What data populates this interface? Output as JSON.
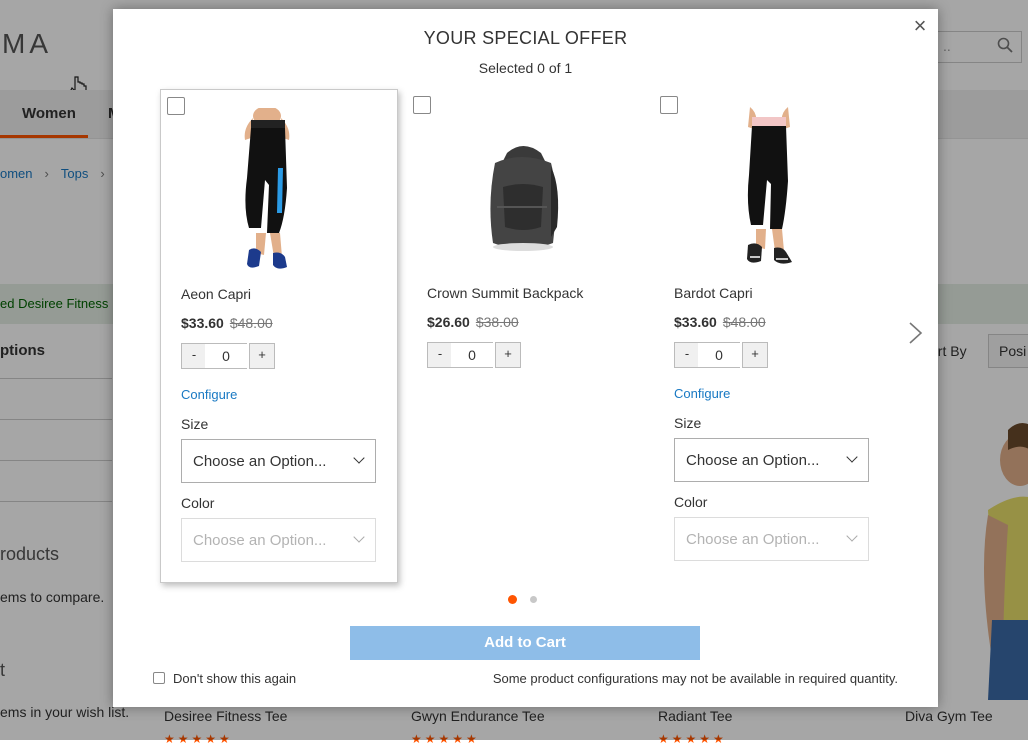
{
  "background": {
    "logo_text": "MA",
    "search_placeholder": "..",
    "nav": {
      "active_label": "Women",
      "next_label": "M"
    },
    "breadcrumb": [
      "omen",
      "Tops"
    ],
    "message_text": "ed Desiree Fitness",
    "options_heading": "ptions",
    "products_heading": "roducts",
    "compare_text": "ems to compare.",
    "wishlist_heading": "t",
    "wishlist_text": "ems in your wish list.",
    "sort_by_label": "ort By",
    "sort_value": "Posi",
    "product_names": [
      "Desiree Fitness Tee",
      "Gwyn Endurance Tee",
      "Radiant Tee",
      "Diva Gym Tee"
    ],
    "stars_glyph": "★★★★★"
  },
  "modal": {
    "title": "YOUR SPECIAL OFFER",
    "subtitle": "Selected 0 of 1",
    "close_glyph": "×",
    "products": [
      {
        "name": "Aeon Capri",
        "price": "$33.60",
        "old_price": "$48.00",
        "qty": "0",
        "minus": "-",
        "plus": "+",
        "configure": "Configure",
        "size_label": "Size",
        "size_value": "Choose an Option...",
        "color_label": "Color",
        "color_value": "Choose an Option..."
      },
      {
        "name": "Crown Summit Backpack",
        "price": "$26.60",
        "old_price": "$38.00",
        "qty": "0",
        "minus": "-",
        "plus": "+"
      },
      {
        "name": "Bardot Capri",
        "price": "$33.60",
        "old_price": "$48.00",
        "qty": "0",
        "minus": "-",
        "plus": "+",
        "configure": "Configure",
        "size_label": "Size",
        "size_value": "Choose an Option...",
        "color_label": "Color",
        "color_value": "Choose an Option..."
      }
    ],
    "add_to_cart": "Add to Cart",
    "dont_show": "Don't show this again",
    "note": "Some product configurations may not be available in required quantity.",
    "colors": {
      "accent": "#ff5501",
      "button": "#8ebde8",
      "link": "#1979c3",
      "dot_inactive": "#c8c8c8"
    }
  }
}
